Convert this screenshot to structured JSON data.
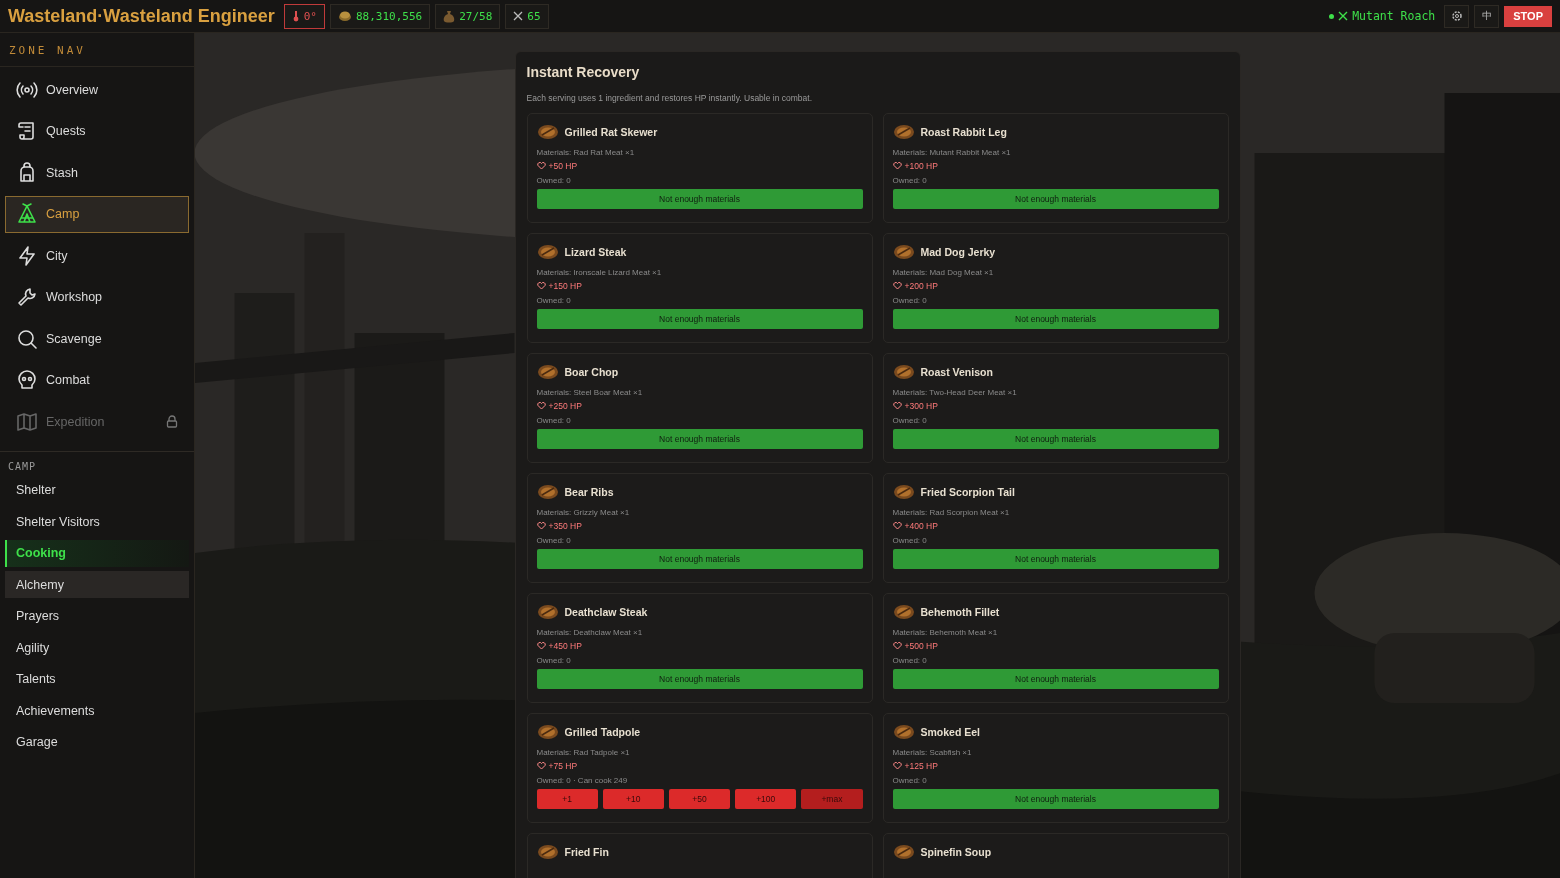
{
  "topbar": {
    "title": "Wasteland·Wasteland Engineer",
    "stats": [
      {
        "kind": "temperature",
        "value": "0°",
        "alert": true
      },
      {
        "kind": "coins",
        "value": "88,310,556",
        "alert": false
      },
      {
        "kind": "bag",
        "value": "27/58",
        "alert": false
      },
      {
        "kind": "swords",
        "value": "65",
        "alert": false
      }
    ],
    "enemy": {
      "name": "Mutant Roach",
      "active": true
    },
    "language": "中",
    "stop": "STOP"
  },
  "sidebar": {
    "heading": "ZONE NAV",
    "items": [
      {
        "label": "Overview",
        "kind": "signal",
        "selected": false,
        "locked": false
      },
      {
        "label": "Quests",
        "kind": "scroll",
        "selected": false,
        "locked": false
      },
      {
        "label": "Stash",
        "kind": "backpack",
        "selected": false,
        "locked": false
      },
      {
        "label": "Camp",
        "kind": "tent",
        "selected": true,
        "locked": false
      },
      {
        "label": "City",
        "kind": "bolt",
        "selected": false,
        "locked": false
      },
      {
        "label": "Workshop",
        "kind": "wrench",
        "selected": false,
        "locked": false
      },
      {
        "label": "Scavenge",
        "kind": "search",
        "selected": false,
        "locked": false
      },
      {
        "label": "Combat",
        "kind": "skull",
        "selected": false,
        "locked": false
      },
      {
        "label": "Expedition",
        "kind": "map",
        "selected": false,
        "locked": true
      }
    ],
    "section": "CAMP",
    "subitems": [
      {
        "label": "Shelter",
        "selected": false,
        "hovered": false
      },
      {
        "label": "Shelter Visitors",
        "selected": false,
        "hovered": false
      },
      {
        "label": "Cooking",
        "selected": true,
        "hovered": false
      },
      {
        "label": "Alchemy",
        "selected": false,
        "hovered": true
      },
      {
        "label": "Prayers",
        "selected": false,
        "hovered": false
      },
      {
        "label": "Agility",
        "selected": false,
        "hovered": false
      },
      {
        "label": "Talents",
        "selected": false,
        "hovered": false
      },
      {
        "label": "Achievements",
        "selected": false,
        "hovered": false
      },
      {
        "label": "Garage",
        "selected": false,
        "hovered": false
      }
    ]
  },
  "panel": {
    "title": "Instant Recovery",
    "description": "Each serving uses 1 ingredient and restores HP instantly. Usable in combat.",
    "recipes": [
      {
        "name": "Grilled Rat Skewer",
        "materials": "Materials: Rad Rat Meat ×1",
        "hp": "+50 HP",
        "owned": "Owned: 0",
        "kind": "insufficient",
        "action": "Not enough materials"
      },
      {
        "name": "Roast Rabbit Leg",
        "materials": "Materials: Mutant Rabbit Meat ×1",
        "hp": "+100 HP",
        "owned": "Owned: 0",
        "kind": "insufficient",
        "action": "Not enough materials"
      },
      {
        "name": "Lizard Steak",
        "materials": "Materials: Ironscale Lizard Meat ×1",
        "hp": "+150 HP",
        "owned": "Owned: 0",
        "kind": "insufficient",
        "action": "Not enough materials"
      },
      {
        "name": "Mad Dog Jerky",
        "materials": "Materials: Mad Dog Meat ×1",
        "hp": "+200 HP",
        "owned": "Owned: 0",
        "kind": "insufficient",
        "action": "Not enough materials"
      },
      {
        "name": "Boar Chop",
        "materials": "Materials: Steel Boar Meat ×1",
        "hp": "+250 HP",
        "owned": "Owned: 0",
        "kind": "insufficient",
        "action": "Not enough materials"
      },
      {
        "name": "Roast Venison",
        "materials": "Materials: Two-Head Deer Meat ×1",
        "hp": "+300 HP",
        "owned": "Owned: 0",
        "kind": "insufficient",
        "action": "Not enough materials"
      },
      {
        "name": "Bear Ribs",
        "materials": "Materials: Grizzly Meat ×1",
        "hp": "+350 HP",
        "owned": "Owned: 0",
        "kind": "insufficient",
        "action": "Not enough materials"
      },
      {
        "name": "Fried Scorpion Tail",
        "materials": "Materials: Rad Scorpion Meat ×1",
        "hp": "+400 HP",
        "owned": "Owned: 0",
        "kind": "insufficient",
        "action": "Not enough materials"
      },
      {
        "name": "Deathclaw Steak",
        "materials": "Materials: Deathclaw Meat ×1",
        "hp": "+450 HP",
        "owned": "Owned: 0",
        "kind": "insufficient",
        "action": "Not enough materials"
      },
      {
        "name": "Behemoth Fillet",
        "materials": "Materials: Behemoth Meat ×1",
        "hp": "+500 HP",
        "owned": "Owned: 0",
        "kind": "insufficient",
        "action": "Not enough materials"
      },
      {
        "name": "Grilled Tadpole",
        "materials": "Materials: Rad Tadpole ×1",
        "hp": "+75 HP",
        "owned": "Owned: 0 · Can cook 249",
        "kind": "cookable",
        "amounts": [
          "+1",
          "+10",
          "+50",
          "+100",
          "+max"
        ]
      },
      {
        "name": "Smoked Eel",
        "materials": "Materials: Scabfish ×1",
        "hp": "+125 HP",
        "owned": "Owned: 0",
        "kind": "insufficient",
        "action": "Not enough materials"
      },
      {
        "name": "Fried Fin",
        "kind": "partial"
      },
      {
        "name": "Spinefin Soup",
        "kind": "partial"
      }
    ]
  }
}
